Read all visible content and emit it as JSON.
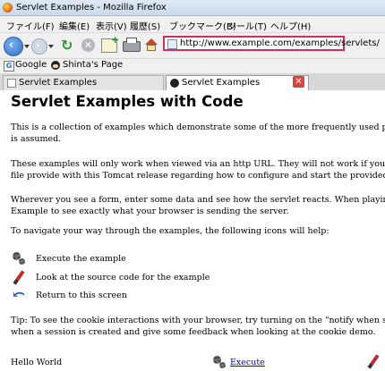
{
  "window": {
    "title": "Servlet Examples - Mozilla Firefox"
  },
  "menu": [
    "ファイル(F)",
    "編集(E)",
    "表示(V)",
    "履歴(S)",
    "ブックマーク(B)",
    "ツール(T)",
    "ヘルプ(H)"
  ],
  "toolbar": {
    "back": "‹",
    "forward": "›",
    "reload": "↻",
    "stop": "✕"
  },
  "address": {
    "url": "http://www.example.com/examples/servlets/"
  },
  "bookmarks": [
    {
      "label": "Google"
    },
    {
      "label": "Shinta's Page"
    }
  ],
  "tabs": [
    {
      "label": "Servlet Examples"
    },
    {
      "label": "Servlet Examples"
    }
  ],
  "tab_close": "✕",
  "page": {
    "title": "Servlet Examples with Code",
    "p1a": "This is a collection of examples which demonstrate some of the more frequently used parts of the Servlet",
    "p1b": "is assumed.",
    "p2a": "These examples will only work when viewed via an http URL. They will not work if you are viewing these",
    "p2b": "file provide with this Tomcat release regarding how to configure and start the provided web server.",
    "p3a": "Wherever you see a form, enter some data and see how the servlet reacts. When playing with the Cookie",
    "p3b": "Example to see exactly what your browser is sending the server.",
    "p4": "To navigate your way through the examples, the following icons will help:",
    "legend": [
      {
        "icon": "execute-gear-icon",
        "label": "Execute the example"
      },
      {
        "icon": "source-pen-icon",
        "label": "Look at the source code for the example"
      },
      {
        "icon": "return-arrow-icon",
        "label": "Return to this screen"
      }
    ],
    "tip_a": "Tip: To see the cookie interactions with your browser, try turning on the \"notify when setting a cookie\" op",
    "tip_b": "when a session is created and give some feedback when looking at the cookie demo.",
    "row_hello": "Hello World",
    "row_execute": "Execute"
  },
  "colors": {
    "url_border": "#d03060",
    "link": "#0000cc"
  }
}
